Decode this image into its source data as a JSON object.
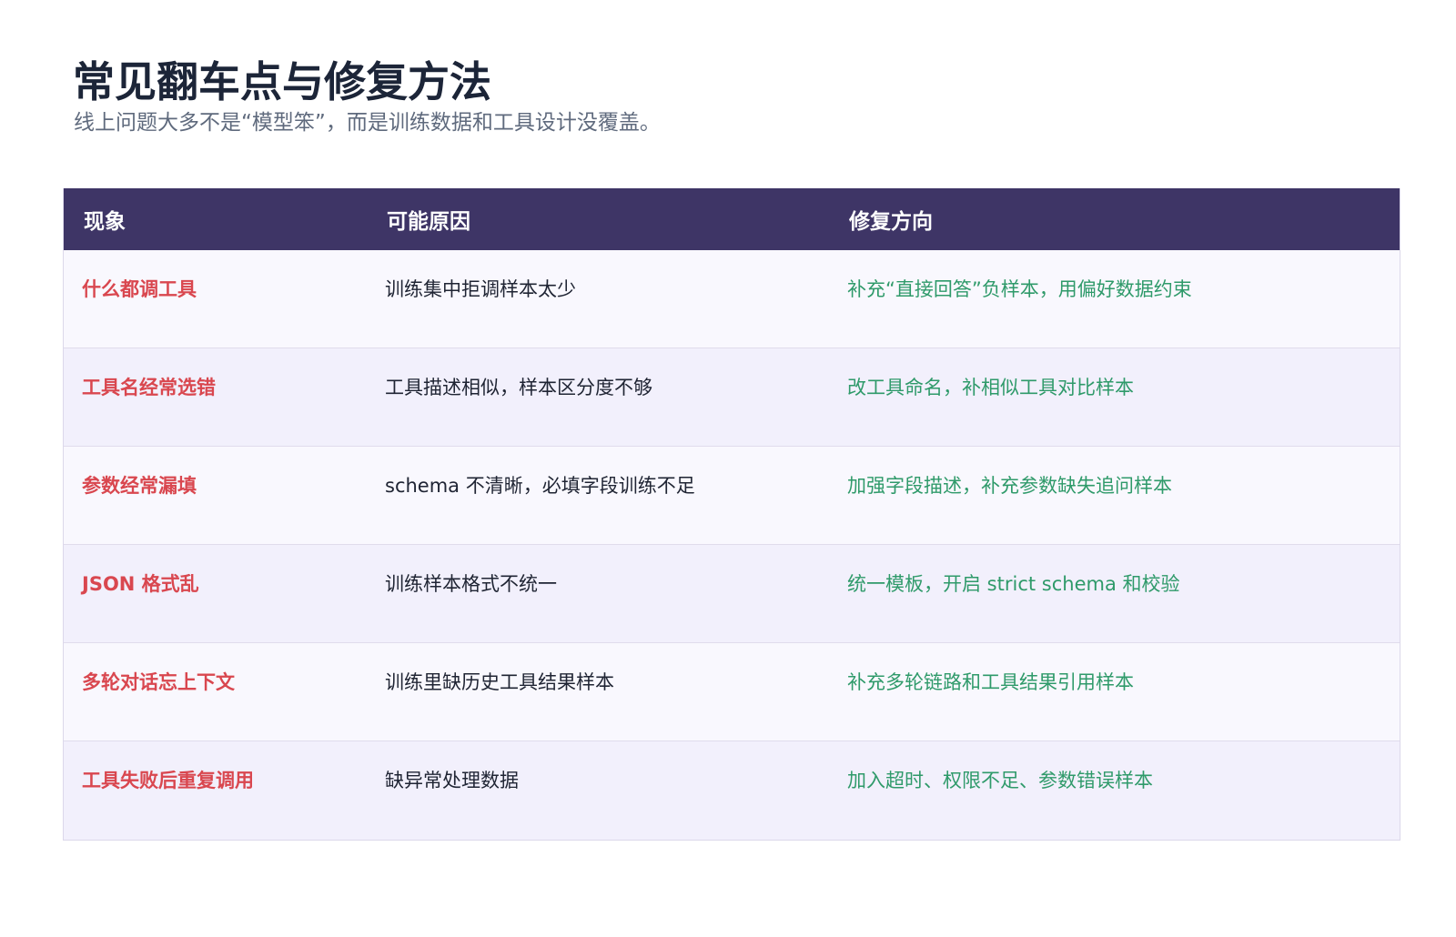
{
  "page": {
    "title": "常见翻车点与修复方法",
    "subtitle": "线上问题大多不是“模型笨”，而是训练数据和工具设计没覆盖。"
  },
  "table": {
    "headers": [
      "现象",
      "可能原因",
      "修复方向"
    ],
    "rows": [
      {
        "symptom": "什么都调工具",
        "cause": "训练集中拒调样本太少",
        "fix": "补充“直接回答”负样本，用偏好数据约束"
      },
      {
        "symptom": "工具名经常选错",
        "cause": "工具描述相似，样本区分度不够",
        "fix": "改工具命名，补相似工具对比样本"
      },
      {
        "symptom": "参数经常漏填",
        "cause": "schema 不清晰，必填字段训练不足",
        "fix": "加强字段描述，补充参数缺失追问样本"
      },
      {
        "symptom": "JSON 格式乱",
        "cause": "训练样本格式不统一",
        "fix": "统一模板，开启 strict schema 和校验"
      },
      {
        "symptom": "多轮对话忘上下文",
        "cause": "训练里缺历史工具结果样本",
        "fix": "补充多轮链路和工具结果引用样本"
      },
      {
        "symptom": "工具失败后重复调用",
        "cause": "缺异常处理数据",
        "fix": "加入超时、权限不足、参数错误样本"
      }
    ]
  },
  "colors": {
    "header_bg": "#3e3566",
    "symptom": "#d9474f",
    "fix": "#2f9a6a",
    "cause": "#1f2433"
  }
}
